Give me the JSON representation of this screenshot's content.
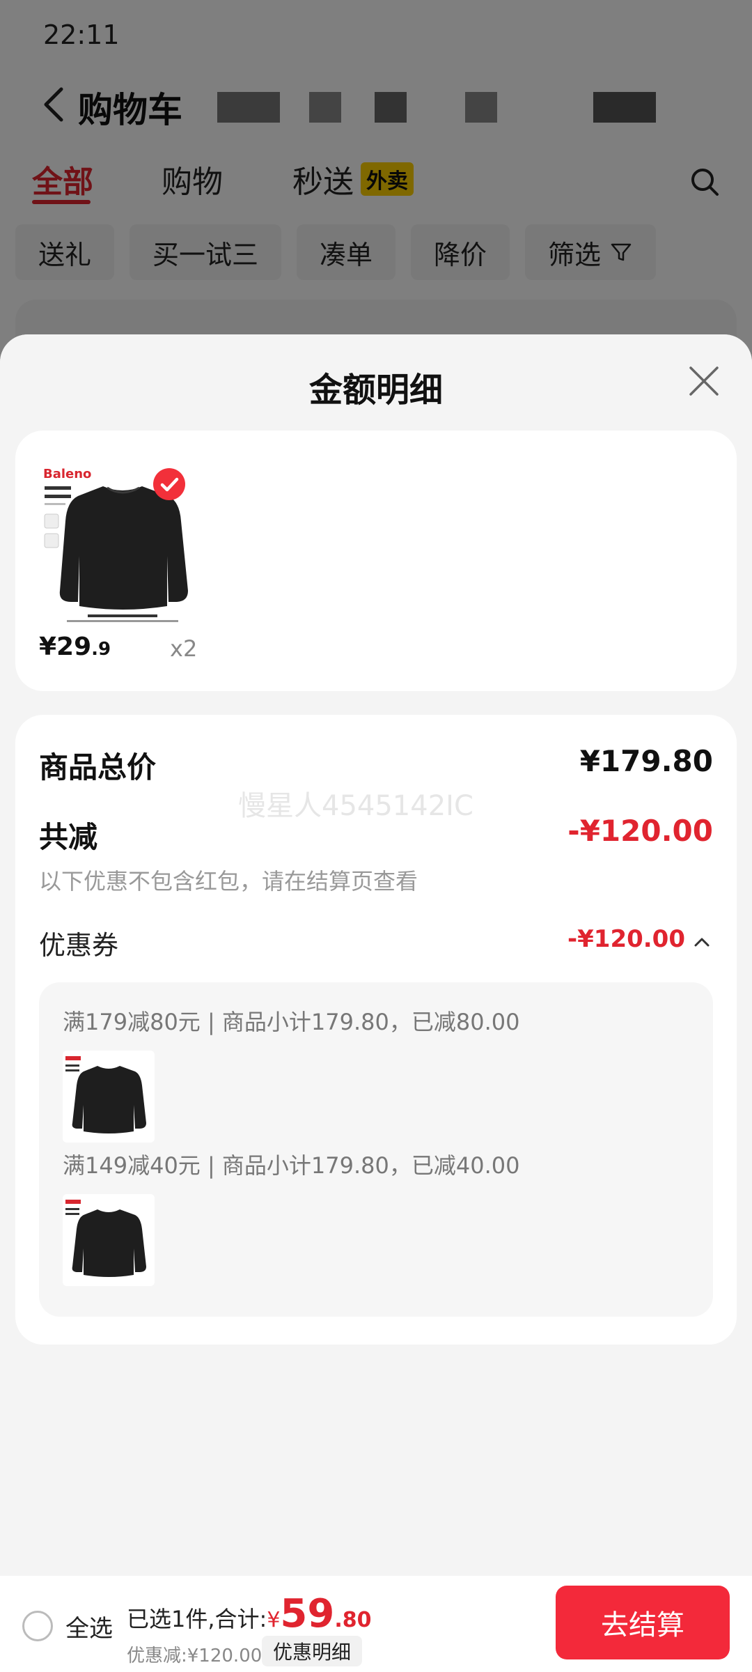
{
  "status_bar": {
    "time": "22:11"
  },
  "header": {
    "title": "购物车"
  },
  "tabs": [
    {
      "label": "全部",
      "active": true
    },
    {
      "label": "购物",
      "active": false
    },
    {
      "label": "秒送",
      "active": false
    }
  ],
  "takeout_badge": "外卖",
  "filter_chips": [
    "送礼",
    "买一试三",
    "凑单",
    "降价",
    "筛选"
  ],
  "sheet": {
    "title": "金额明细",
    "product": {
      "brand_text": "Baleno",
      "price_int": "¥29",
      "price_dec": ".9",
      "quantity": "x2",
      "checked": true
    },
    "watermark": "慢星人4545142IC",
    "total_label": "商品总价",
    "total_value": "¥179.80",
    "reduce_label": "共减",
    "reduce_value": "-¥120.00",
    "note": "以下优惠不包含红包，请在结算页查看",
    "coupon_label": "优惠券",
    "coupon_value": "-¥120.00",
    "coupon_rules": [
      "满179减80元 | 商品小计179.80，已减80.00",
      "满149减40元 | 商品小计179.80，已减40.00"
    ]
  },
  "bottom_bar": {
    "select_all": "全选",
    "summary_prefix": "已选1件,合计:",
    "total_symbol": "¥",
    "total_int": "59",
    "total_dec": ".80",
    "discount": "优惠减:¥120.00",
    "detail_button": "优惠明细",
    "checkout_button": "去结算"
  },
  "colors": {
    "accent": "#e0242f",
    "checkout": "#f3293a",
    "badge": "#ffd100"
  }
}
